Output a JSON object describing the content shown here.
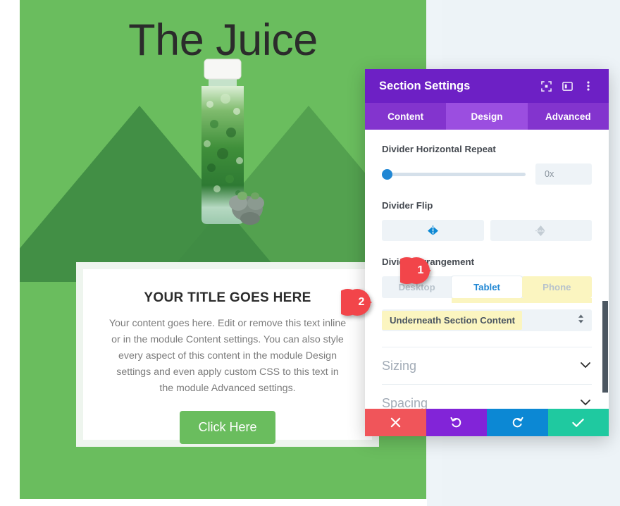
{
  "hero": {
    "title": "The Juice",
    "background_color": "#6abd5e",
    "divider_color": "#3f8b43",
    "card": {
      "title": "YOUR TITLE GOES HERE",
      "body": "Your content goes here. Edit or remove this text inline or in the module Content settings. You can also style every aspect of this content in the module Design settings and even apply custom CSS to this text in the module Advanced settings.",
      "cta_label": "Click Here",
      "cta_color": "#6abd5e"
    }
  },
  "modal": {
    "title": "Section Settings",
    "header_color": "#6d20c5",
    "header_icons": [
      {
        "name": "focus-icon"
      },
      {
        "name": "layout-panel-icon"
      },
      {
        "name": "more-vertical-icon"
      }
    ],
    "tabs": [
      {
        "label": "Content",
        "active": false
      },
      {
        "label": "Design",
        "active": true
      },
      {
        "label": "Advanced",
        "active": false
      }
    ],
    "fields": {
      "horizontal_repeat": {
        "label": "Divider Horizontal Repeat",
        "value": "0x",
        "slider_percent": 0,
        "handle_color": "#2087d4"
      },
      "divider_flip": {
        "label": "Divider Flip",
        "options": [
          {
            "name": "flip-horizontal-icon",
            "active": true
          },
          {
            "name": "flip-vertical-icon",
            "active": false
          }
        ]
      },
      "divider_arrangement": {
        "label": "Divider Arrangement",
        "devices": [
          {
            "label": "Desktop",
            "active": false,
            "highlighted": false
          },
          {
            "label": "Tablet",
            "active": true,
            "highlighted": true
          },
          {
            "label": "Phone",
            "active": false,
            "highlighted": true
          }
        ],
        "selected_value": "Underneath Section Content",
        "highlight_color": "#fbf5c0"
      }
    },
    "accordions": [
      {
        "label": "Sizing"
      },
      {
        "label": "Spacing"
      }
    ],
    "footer_buttons": [
      {
        "name": "cancel-button",
        "icon": "close-icon",
        "color": "#f0555a"
      },
      {
        "name": "undo-button",
        "icon": "undo-icon",
        "color": "#8224d8"
      },
      {
        "name": "redo-button",
        "icon": "redo-icon",
        "color": "#0c88d4"
      },
      {
        "name": "save-button",
        "icon": "check-icon",
        "color": "#1fc9a0"
      }
    ]
  },
  "markers": [
    {
      "number": "1",
      "color": "#f2454a"
    },
    {
      "number": "2",
      "color": "#f2454a"
    }
  ]
}
